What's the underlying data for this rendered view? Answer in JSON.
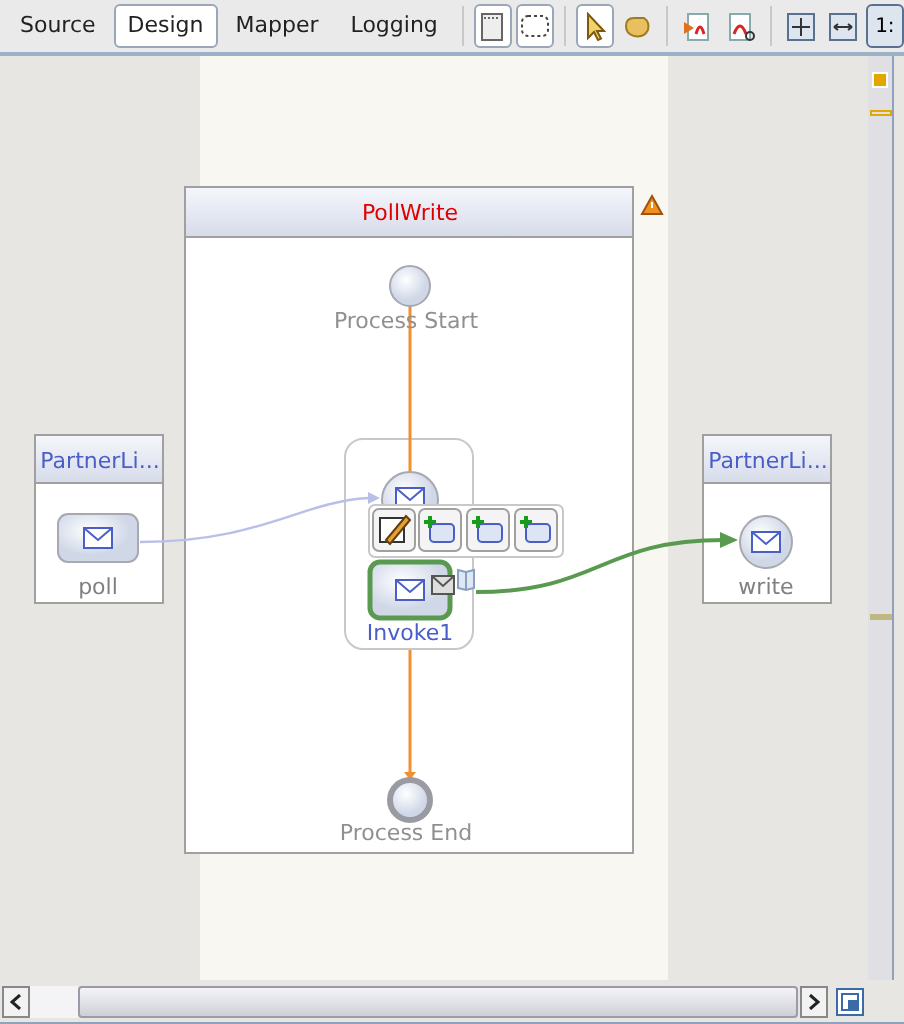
{
  "tabs": [
    {
      "label": "Source",
      "selected": false
    },
    {
      "label": "Design",
      "selected": true
    },
    {
      "label": "Mapper",
      "selected": false
    },
    {
      "label": "Logging",
      "selected": false
    }
  ],
  "toolbar": [
    {
      "kind": "palette",
      "selected": true
    },
    {
      "kind": "marquee",
      "selected": true
    },
    {
      "kind": "select",
      "selected": true
    },
    {
      "kind": "hand",
      "selected": false
    },
    {
      "kind": "export",
      "selected": false
    },
    {
      "kind": "print",
      "selected": false
    },
    {
      "kind": "fit",
      "selected": false
    },
    {
      "kind": "fit-width",
      "selected": false
    },
    {
      "kind": "actual-size",
      "label": "1:"
    }
  ],
  "process": {
    "title": "PollWrite",
    "start_label": "Process Start",
    "end_label": "Process End",
    "invoke": {
      "label": "Invoke1",
      "selected": true
    }
  },
  "partner_links": [
    {
      "title": "PartnerLi...",
      "operation": "poll",
      "kind": "box"
    },
    {
      "title": "PartnerLi...",
      "operation": "write",
      "kind": "circle"
    }
  ]
}
